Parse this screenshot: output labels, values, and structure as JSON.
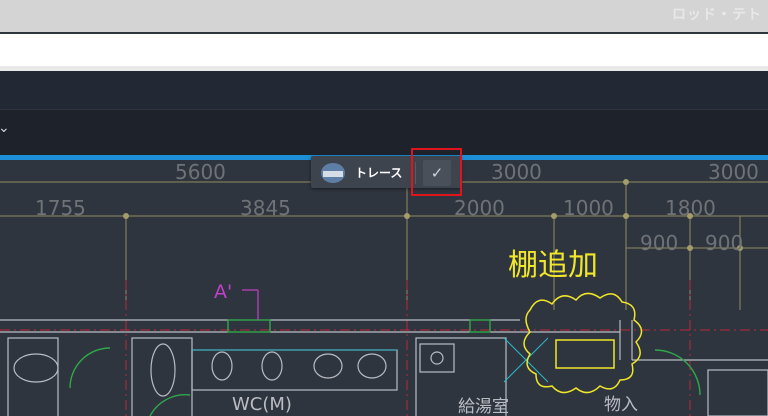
{
  "watermark": "ロッド・テト",
  "nav": {
    "dropdown_chevron": "chevron-down-icon"
  },
  "toolbar": {
    "trace_label": "トレース",
    "confirm_icon": "check-icon"
  },
  "drawing": {
    "dims_row1": [
      "5600",
      "3000",
      "3000"
    ],
    "dims_row2": [
      "1755",
      "3845",
      "2000",
      "1000",
      "1800"
    ],
    "dims_row3": [
      "900",
      "900"
    ],
    "section_mark": "A'",
    "shelf_label": "棚追加",
    "rooms": [
      "WC(M)",
      "給湯室",
      "物入"
    ]
  },
  "colors": {
    "accent_blue": "#1c8fd6",
    "highlight_red": "#e0141c",
    "annotation_yellow": "#f0e62a",
    "section_magenta": "#c040c8"
  }
}
